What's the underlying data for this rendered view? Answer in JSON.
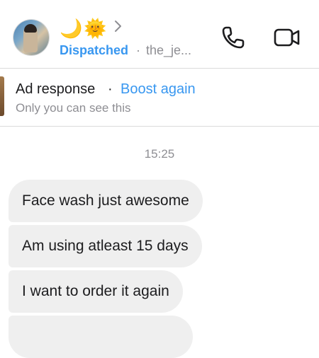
{
  "header": {
    "emoji_moon": "🌙",
    "emoji_sun": "🌞",
    "status": "Dispatched",
    "separator": "·",
    "handle": "the_je..."
  },
  "ad": {
    "title": "Ad response",
    "separator": "·",
    "boost_label": "Boost again",
    "subtitle": "Only you can see this"
  },
  "thread": {
    "timestamp": "15:25",
    "messages": [
      "Face wash just awesome",
      "Am using atleast 15 days",
      "I want to order it again"
    ]
  },
  "colors": {
    "accent": "#3897f0",
    "bubble": "#efefef",
    "secondary_text": "#8e8e93"
  },
  "icons": [
    "profile-avatar",
    "chevron-right-icon",
    "phone-icon",
    "video-camera-icon"
  ]
}
